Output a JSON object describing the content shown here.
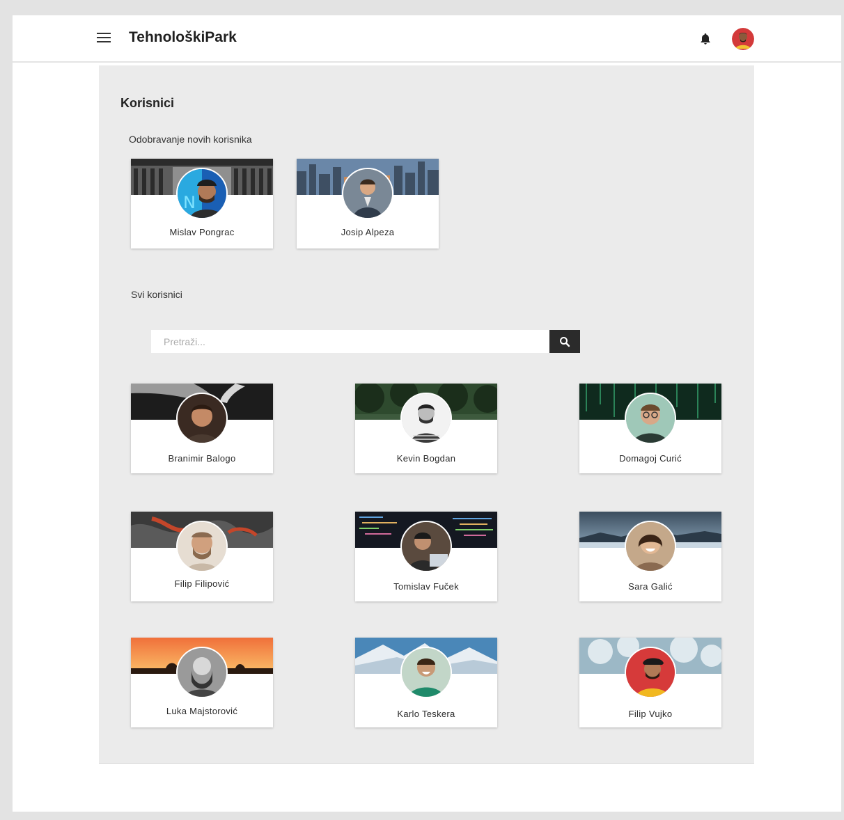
{
  "header": {
    "app_title": "TehnološkiPark",
    "menu_icon": "hamburger-menu-icon",
    "bell_icon": "bell-icon"
  },
  "page": {
    "title": "Korisnici",
    "pending_section_label": "Odobravanje novih korisnika",
    "all_section_label": "Svi korisnici"
  },
  "search": {
    "placeholder": "Pretraži...",
    "value": "",
    "button_icon": "search-icon"
  },
  "pending_users": [
    {
      "name": "Mislav Pongrac"
    },
    {
      "name": "Josip Alpeza"
    }
  ],
  "all_users": [
    {
      "name": "Branimir Balogo"
    },
    {
      "name": "Kevin Bogdan"
    },
    {
      "name": "Domagoj Curić"
    },
    {
      "name": "Filip Filipović"
    },
    {
      "name": "Tomislav Fuček"
    },
    {
      "name": "Sara Galić"
    },
    {
      "name": "Luka Majstorović"
    },
    {
      "name": "Karlo Teskera"
    },
    {
      "name": "Filip Vujko"
    }
  ],
  "colors": {
    "content_bg": "#ebebeb",
    "search_button": "#2b2b2b"
  }
}
